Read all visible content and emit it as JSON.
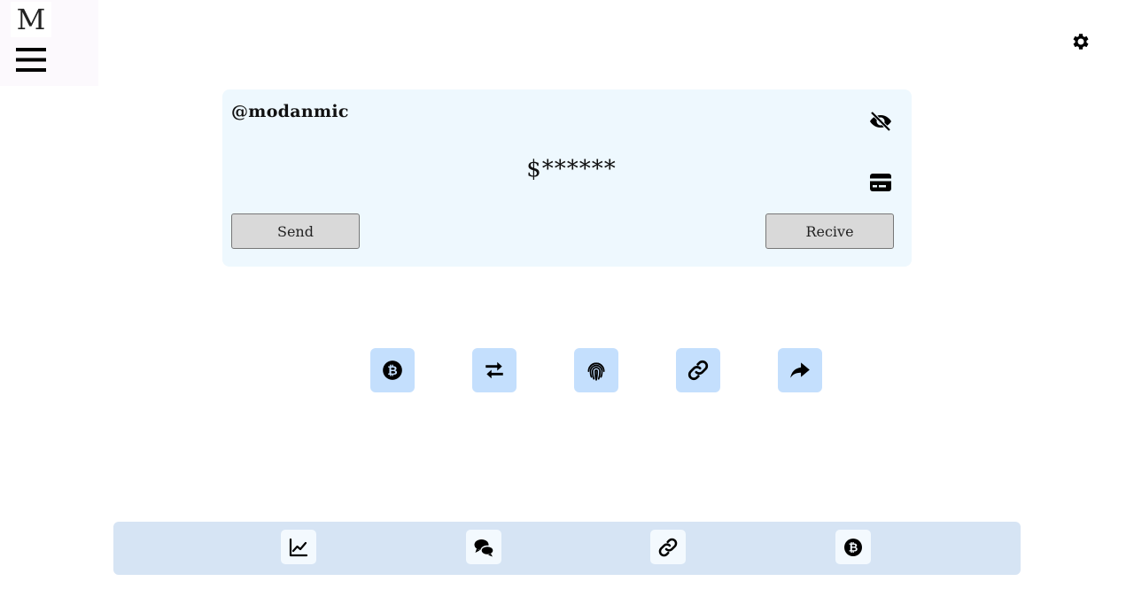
{
  "logo": {
    "letter": "M"
  },
  "header": {
    "menu_icon": "hamburger-menu-icon",
    "settings_icon": "gear-icon"
  },
  "wallet": {
    "username": "@modanmic",
    "balance": "$******",
    "visibility_icon": "eye-slash-icon",
    "card_icon": "credit-card-icon",
    "send_label": "Send",
    "receive_label": "Recive"
  },
  "actions": [
    {
      "icon": "bitcoin-icon"
    },
    {
      "icon": "transfer-arrows-icon"
    },
    {
      "icon": "fingerprint-icon"
    },
    {
      "icon": "link-icon"
    },
    {
      "icon": "share-icon"
    }
  ],
  "bottom_nav": [
    {
      "icon": "chart-line-icon"
    },
    {
      "icon": "comments-icon"
    },
    {
      "icon": "link-icon"
    },
    {
      "icon": "bitcoin-icon"
    }
  ],
  "colors": {
    "card_bg": "#eef8fe",
    "action_bg": "#c4dffd",
    "bottombar_bg": "#d6e4f4",
    "button_bg": "#d9d9d9"
  }
}
